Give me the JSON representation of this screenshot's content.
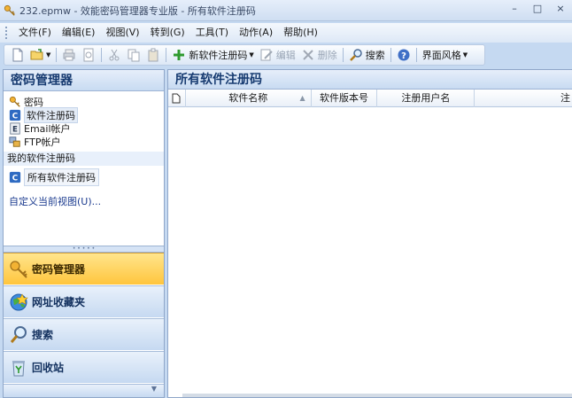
{
  "window": {
    "title": "232.epmw - 效能密码管理器专业版 - 所有软件注册码",
    "controls": {
      "minimize": "–",
      "maximize": "□",
      "close": "×"
    }
  },
  "menu": [
    "文件(F)",
    "编辑(E)",
    "视图(V)",
    "转到(G)",
    "工具(T)",
    "动作(A)",
    "帮助(H)"
  ],
  "toolbar": {
    "new_serial": "新软件注册码",
    "edit": "编辑",
    "delete": "删除",
    "search": "搜索",
    "theme": "界面风格"
  },
  "left_panel": {
    "title": "密码管理器",
    "tree": [
      {
        "label": "密码",
        "icon": "key-icon"
      },
      {
        "label": "软件注册码",
        "icon": "serial-icon",
        "selected": true
      },
      {
        "label": "Email帐户",
        "icon": "email-icon"
      },
      {
        "label": "FTP帐户",
        "icon": "ftp-icon"
      }
    ],
    "group_title": "我的软件注册码",
    "my_item": "所有软件注册码",
    "custom_view": "自定义当前视图(U)..."
  },
  "nav": [
    {
      "label": "密码管理器",
      "icon": "key-icon",
      "active": true
    },
    {
      "label": "网址收藏夹",
      "icon": "globe-icon"
    },
    {
      "label": "搜索",
      "icon": "search-icon"
    },
    {
      "label": "回收站",
      "icon": "recycle-icon"
    }
  ],
  "right_panel": {
    "title": "所有软件注册码",
    "columns": [
      "软件名称",
      "软件版本号",
      "注册用户名",
      "注"
    ]
  },
  "colors": {
    "accent": "#ffc53d",
    "header_text": "#163a70",
    "link": "#1b3b8f"
  }
}
